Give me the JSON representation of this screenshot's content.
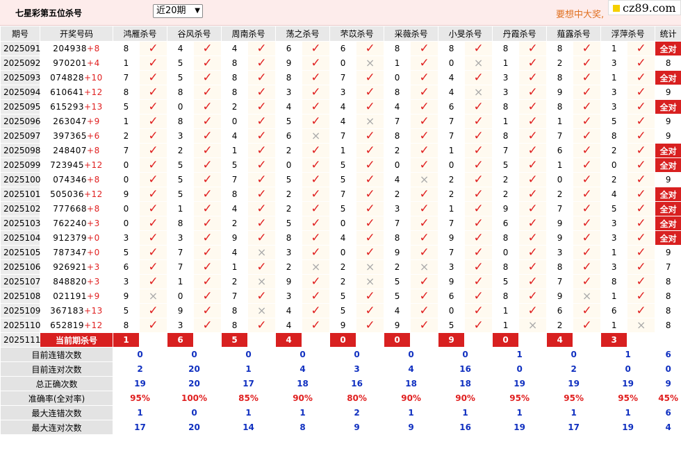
{
  "header": {
    "title": "七星彩第五位杀号",
    "period_select": "近20期",
    "promo": "要想中大奖,",
    "logo_text": "cz89.com"
  },
  "columns": [
    "期号",
    "开奖号码",
    "鸿雁杀号",
    "谷风杀号",
    "周南杀号",
    "荡之杀号",
    "芣苡杀号",
    "采薇杀号",
    "小旻杀号",
    "丹霞杀号",
    "薤露杀号",
    "浮萍杀号",
    "统计"
  ],
  "rows": [
    {
      "issue": "2025091",
      "digits": "204938",
      "extra": "+8",
      "kills": [
        [
          8,
          1
        ],
        [
          4,
          1
        ],
        [
          4,
          1
        ],
        [
          6,
          1
        ],
        [
          6,
          1
        ],
        [
          8,
          1
        ],
        [
          8,
          1
        ],
        [
          8,
          1
        ],
        [
          8,
          1
        ],
        [
          1,
          1
        ]
      ],
      "stat": "全对"
    },
    {
      "issue": "2025092",
      "digits": "970201",
      "extra": "+4",
      "kills": [
        [
          1,
          1
        ],
        [
          5,
          1
        ],
        [
          8,
          1
        ],
        [
          9,
          1
        ],
        [
          0,
          0
        ],
        [
          1,
          1
        ],
        [
          0,
          0
        ],
        [
          1,
          1
        ],
        [
          2,
          1
        ],
        [
          3,
          1
        ]
      ],
      "stat": "8"
    },
    {
      "issue": "2025093",
      "digits": "074828",
      "extra": "+10",
      "kills": [
        [
          7,
          1
        ],
        [
          5,
          1
        ],
        [
          8,
          1
        ],
        [
          8,
          1
        ],
        [
          7,
          1
        ],
        [
          0,
          1
        ],
        [
          4,
          1
        ],
        [
          3,
          1
        ],
        [
          8,
          1
        ],
        [
          1,
          1
        ]
      ],
      "stat": "全对"
    },
    {
      "issue": "2025094",
      "digits": "610641",
      "extra": "+12",
      "kills": [
        [
          8,
          1
        ],
        [
          8,
          1
        ],
        [
          8,
          1
        ],
        [
          3,
          1
        ],
        [
          3,
          1
        ],
        [
          8,
          1
        ],
        [
          4,
          0
        ],
        [
          3,
          1
        ],
        [
          9,
          1
        ],
        [
          3,
          1
        ]
      ],
      "stat": "9"
    },
    {
      "issue": "2025095",
      "digits": "615293",
      "extra": "+13",
      "kills": [
        [
          5,
          1
        ],
        [
          0,
          1
        ],
        [
          2,
          1
        ],
        [
          4,
          1
        ],
        [
          4,
          1
        ],
        [
          4,
          1
        ],
        [
          6,
          1
        ],
        [
          8,
          1
        ],
        [
          8,
          1
        ],
        [
          3,
          1
        ]
      ],
      "stat": "全对"
    },
    {
      "issue": "2025096",
      "digits": "263047",
      "extra": "+9",
      "kills": [
        [
          1,
          1
        ],
        [
          8,
          1
        ],
        [
          0,
          1
        ],
        [
          5,
          1
        ],
        [
          4,
          0
        ],
        [
          7,
          1
        ],
        [
          7,
          1
        ],
        [
          1,
          1
        ],
        [
          1,
          1
        ],
        [
          5,
          1
        ]
      ],
      "stat": "9"
    },
    {
      "issue": "2025097",
      "digits": "397365",
      "extra": "+6",
      "kills": [
        [
          2,
          1
        ],
        [
          3,
          1
        ],
        [
          4,
          1
        ],
        [
          6,
          0
        ],
        [
          7,
          1
        ],
        [
          8,
          1
        ],
        [
          7,
          1
        ],
        [
          8,
          1
        ],
        [
          7,
          1
        ],
        [
          8,
          1
        ]
      ],
      "stat": "9"
    },
    {
      "issue": "2025098",
      "digits": "248407",
      "extra": "+8",
      "kills": [
        [
          7,
          1
        ],
        [
          2,
          1
        ],
        [
          1,
          1
        ],
        [
          2,
          1
        ],
        [
          1,
          1
        ],
        [
          2,
          1
        ],
        [
          1,
          1
        ],
        [
          7,
          1
        ],
        [
          6,
          1
        ],
        [
          2,
          1
        ]
      ],
      "stat": "全对"
    },
    {
      "issue": "2025099",
      "digits": "723945",
      "extra": "+12",
      "kills": [
        [
          0,
          1
        ],
        [
          5,
          1
        ],
        [
          5,
          1
        ],
        [
          0,
          1
        ],
        [
          5,
          1
        ],
        [
          0,
          1
        ],
        [
          0,
          1
        ],
        [
          5,
          1
        ],
        [
          1,
          1
        ],
        [
          0,
          1
        ]
      ],
      "stat": "全对"
    },
    {
      "issue": "2025100",
      "digits": "074346",
      "extra": "+8",
      "kills": [
        [
          0,
          1
        ],
        [
          5,
          1
        ],
        [
          7,
          1
        ],
        [
          5,
          1
        ],
        [
          5,
          1
        ],
        [
          4,
          0
        ],
        [
          2,
          1
        ],
        [
          2,
          1
        ],
        [
          0,
          1
        ],
        [
          2,
          1
        ]
      ],
      "stat": "9"
    },
    {
      "issue": "2025101",
      "digits": "505036",
      "extra": "+12",
      "kills": [
        [
          9,
          1
        ],
        [
          5,
          1
        ],
        [
          8,
          1
        ],
        [
          2,
          1
        ],
        [
          7,
          1
        ],
        [
          2,
          1
        ],
        [
          2,
          1
        ],
        [
          2,
          1
        ],
        [
          2,
          1
        ],
        [
          4,
          1
        ]
      ],
      "stat": "全对"
    },
    {
      "issue": "2025102",
      "digits": "777668",
      "extra": "+8",
      "kills": [
        [
          0,
          1
        ],
        [
          1,
          1
        ],
        [
          4,
          1
        ],
        [
          2,
          1
        ],
        [
          5,
          1
        ],
        [
          3,
          1
        ],
        [
          1,
          1
        ],
        [
          9,
          1
        ],
        [
          7,
          1
        ],
        [
          5,
          1
        ]
      ],
      "stat": "全对"
    },
    {
      "issue": "2025103",
      "digits": "762240",
      "extra": "+3",
      "kills": [
        [
          0,
          1
        ],
        [
          8,
          1
        ],
        [
          2,
          1
        ],
        [
          5,
          1
        ],
        [
          0,
          1
        ],
        [
          7,
          1
        ],
        [
          7,
          1
        ],
        [
          6,
          1
        ],
        [
          9,
          1
        ],
        [
          3,
          1
        ]
      ],
      "stat": "全对"
    },
    {
      "issue": "2025104",
      "digits": "912379",
      "extra": "+0",
      "kills": [
        [
          3,
          1
        ],
        [
          3,
          1
        ],
        [
          9,
          1
        ],
        [
          8,
          1
        ],
        [
          4,
          1
        ],
        [
          8,
          1
        ],
        [
          9,
          1
        ],
        [
          8,
          1
        ],
        [
          9,
          1
        ],
        [
          3,
          1
        ]
      ],
      "stat": "全对"
    },
    {
      "issue": "2025105",
      "digits": "787347",
      "extra": "+0",
      "kills": [
        [
          5,
          1
        ],
        [
          7,
          1
        ],
        [
          4,
          0
        ],
        [
          3,
          1
        ],
        [
          0,
          1
        ],
        [
          9,
          1
        ],
        [
          7,
          1
        ],
        [
          0,
          1
        ],
        [
          3,
          1
        ],
        [
          1,
          1
        ]
      ],
      "stat": "9"
    },
    {
      "issue": "2025106",
      "digits": "926921",
      "extra": "+3",
      "kills": [
        [
          6,
          1
        ],
        [
          7,
          1
        ],
        [
          1,
          1
        ],
        [
          2,
          0
        ],
        [
          2,
          0
        ],
        [
          2,
          0
        ],
        [
          3,
          1
        ],
        [
          8,
          1
        ],
        [
          8,
          1
        ],
        [
          3,
          1
        ]
      ],
      "stat": "7"
    },
    {
      "issue": "2025107",
      "digits": "848820",
      "extra": "+3",
      "kills": [
        [
          3,
          1
        ],
        [
          1,
          1
        ],
        [
          2,
          0
        ],
        [
          9,
          1
        ],
        [
          2,
          0
        ],
        [
          5,
          1
        ],
        [
          9,
          1
        ],
        [
          5,
          1
        ],
        [
          7,
          1
        ],
        [
          8,
          1
        ]
      ],
      "stat": "8"
    },
    {
      "issue": "2025108",
      "digits": "021191",
      "extra": "+9",
      "kills": [
        [
          9,
          0
        ],
        [
          0,
          1
        ],
        [
          7,
          1
        ],
        [
          3,
          1
        ],
        [
          5,
          1
        ],
        [
          5,
          1
        ],
        [
          6,
          1
        ],
        [
          8,
          1
        ],
        [
          9,
          0
        ],
        [
          1,
          1
        ]
      ],
      "stat": "8"
    },
    {
      "issue": "2025109",
      "digits": "367183",
      "extra": "+13",
      "kills": [
        [
          5,
          1
        ],
        [
          9,
          1
        ],
        [
          8,
          0
        ],
        [
          4,
          1
        ],
        [
          5,
          1
        ],
        [
          4,
          1
        ],
        [
          0,
          1
        ],
        [
          1,
          1
        ],
        [
          6,
          1
        ],
        [
          6,
          1
        ]
      ],
      "stat": "8"
    },
    {
      "issue": "2025110",
      "digits": "652819",
      "extra": "+12",
      "kills": [
        [
          8,
          1
        ],
        [
          3,
          1
        ],
        [
          8,
          1
        ],
        [
          4,
          1
        ],
        [
          9,
          1
        ],
        [
          9,
          1
        ],
        [
          5,
          1
        ],
        [
          1,
          0
        ],
        [
          2,
          1
        ],
        [
          1,
          0
        ]
      ],
      "stat": "8"
    }
  ],
  "current": {
    "issue": "2025111",
    "label": "当前期杀号",
    "kills": [
      "1",
      "6",
      "5",
      "4",
      "0",
      "0",
      "9",
      "0",
      "4",
      "3"
    ]
  },
  "stats": [
    {
      "label": "目前连错次数",
      "values": [
        "0",
        "0",
        "0",
        "0",
        "0",
        "0",
        "0",
        "1",
        "0",
        "1",
        "6"
      ]
    },
    {
      "label": "目前连对次数",
      "values": [
        "2",
        "20",
        "1",
        "4",
        "3",
        "4",
        "16",
        "0",
        "2",
        "0",
        "0"
      ]
    },
    {
      "label": "总正确次数",
      "values": [
        "19",
        "20",
        "17",
        "18",
        "16",
        "18",
        "18",
        "19",
        "19",
        "19",
        "9"
      ]
    },
    {
      "label": "准确率(全对率)",
      "values": [
        "95%",
        "100%",
        "85%",
        "90%",
        "80%",
        "90%",
        "90%",
        "95%",
        "95%",
        "95%",
        "45%"
      ],
      "red": true
    },
    {
      "label": "最大连错次数",
      "values": [
        "1",
        "0",
        "1",
        "1",
        "2",
        "1",
        "1",
        "1",
        "1",
        "1",
        "6"
      ]
    },
    {
      "label": "最大连对次数",
      "values": [
        "17",
        "20",
        "14",
        "8",
        "9",
        "9",
        "16",
        "19",
        "17",
        "19",
        "4"
      ]
    }
  ],
  "marks": {
    "ok": "✓",
    "no": "×"
  }
}
